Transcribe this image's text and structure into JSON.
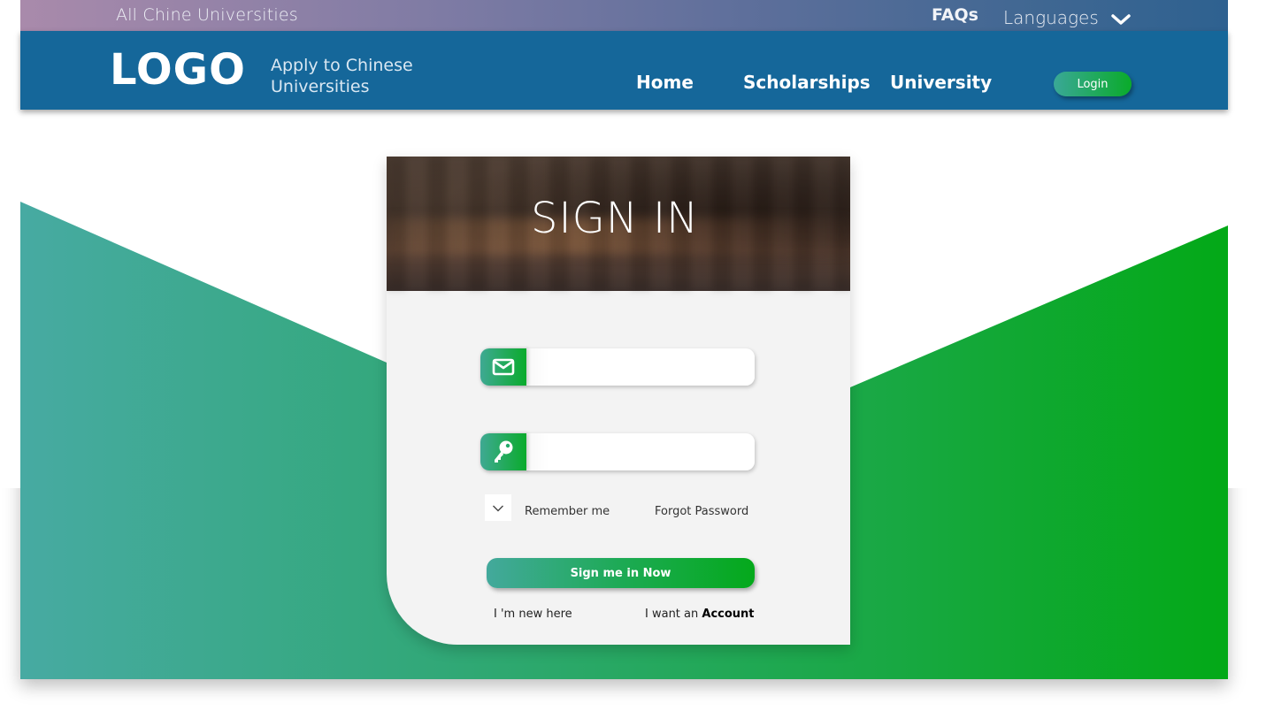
{
  "topbar": {
    "brand": "All Chine Universities",
    "faqs": "FAQs",
    "languages": "Languages"
  },
  "header": {
    "logo": "LOGO",
    "tagline_line1": "Apply to Chinese",
    "tagline_line2": "Universities",
    "nav": [
      "Home",
      "Scholarships",
      "University"
    ],
    "login_label": "Login"
  },
  "signin": {
    "title": "SIGN IN",
    "email_value": "",
    "password_value": "",
    "remember_label": "Remember me",
    "remember_checked": true,
    "forgot_label": "Forgot Password",
    "submit_label": "Sign me in Now",
    "new_here": "I 'm new here",
    "want_prefix": "I want an",
    "want_account": "Account"
  },
  "colors": {
    "header_blue": "#15679a",
    "green_end": "#03a917",
    "teal_start": "#47aaa2"
  },
  "icons": [
    "chevron-down-icon",
    "envelope-icon",
    "key-icon",
    "check-icon"
  ]
}
